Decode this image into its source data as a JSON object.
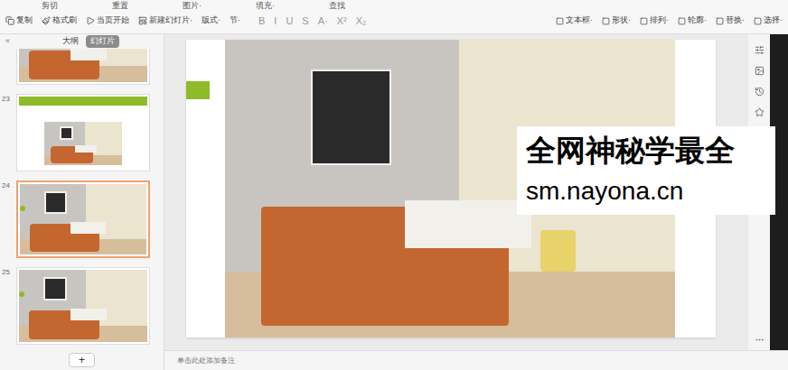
{
  "toolbar": {
    "top_row": [
      "剪切",
      "重置",
      "图片·",
      "填充·",
      "查找"
    ],
    "left_group": [
      "复制",
      "格式刷",
      "当页开始",
      "新建幻灯片·",
      "版式·",
      "节·"
    ],
    "format_buttons": [
      "B",
      "I",
      "U",
      "S",
      "A·",
      "X²",
      "X₂"
    ],
    "right_group": [
      "文本框·",
      "形状·",
      "排列·",
      "轮廓·",
      "替换·",
      "选择·"
    ]
  },
  "panel": {
    "collapse": "«",
    "tabs": [
      {
        "label": "大纲",
        "selected": false
      },
      {
        "label": "幻灯片",
        "selected": true
      }
    ],
    "slides": [
      {
        "number": "",
        "selected": false,
        "kind": "photo"
      },
      {
        "number": "23",
        "selected": false,
        "kind": "header"
      },
      {
        "number": "24",
        "selected": true,
        "kind": "photo"
      },
      {
        "number": "25",
        "selected": false,
        "kind": "photo"
      }
    ],
    "add_slide": "+"
  },
  "notes_placeholder": "单击此处添加备注",
  "watermark": {
    "line1": "全网神秘学最全",
    "line2": "sm.nayona.cn"
  }
}
